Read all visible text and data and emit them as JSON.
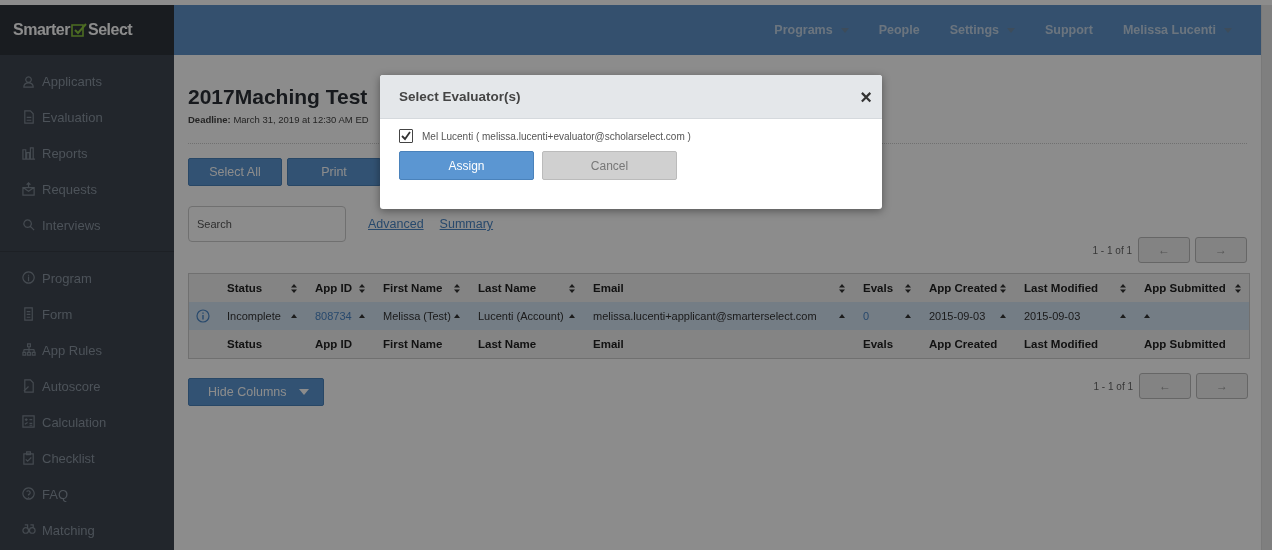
{
  "logo": {
    "before": "Smarter",
    "after": "Select"
  },
  "nav": [
    {
      "label": "Programs",
      "dropdown": true
    },
    {
      "label": "People",
      "dropdown": false
    },
    {
      "label": "Settings",
      "dropdown": true
    },
    {
      "label": "Support",
      "dropdown": false
    },
    {
      "label": "Melissa Lucenti",
      "dropdown": true
    }
  ],
  "sidebar": {
    "groups": [
      [
        {
          "label": "Applicants"
        },
        {
          "label": "Evaluation"
        },
        {
          "label": "Reports"
        },
        {
          "label": "Requests"
        },
        {
          "label": "Interviews"
        }
      ],
      [
        {
          "label": "Program"
        },
        {
          "label": "Form"
        },
        {
          "label": "App Rules"
        },
        {
          "label": "Autoscore"
        },
        {
          "label": "Calculation"
        },
        {
          "label": "Checklist"
        },
        {
          "label": "FAQ"
        },
        {
          "label": "Matching"
        }
      ]
    ]
  },
  "page": {
    "title": "2017Maching Test",
    "deadline_label": "Deadline:",
    "deadline": "March 31, 2019 at 12:30 AM ED"
  },
  "actions": [
    "Select All",
    "Print"
  ],
  "search": {
    "placeholder": "Search"
  },
  "links": [
    "Advanced",
    "Summary"
  ],
  "pagination": {
    "range": "1 - 1 of 1",
    "prev": "←",
    "next": "→"
  },
  "table": {
    "columns": [
      "Status",
      "App ID",
      "First Name",
      "Last Name",
      "Email",
      "Evals",
      "App Created",
      "Last Modified",
      "App Submitted"
    ],
    "rows": [
      {
        "selected": true,
        "cells": [
          {
            "text": "Incomplete",
            "link": false
          },
          {
            "text": "808734",
            "link": true
          },
          {
            "text": "Melissa (Test)",
            "link": false
          },
          {
            "text": "Lucenti (Account)",
            "link": false
          },
          {
            "text": "melissa.lucenti+applicant@smarterselect.com",
            "link": false
          },
          {
            "text": "0",
            "link": true
          },
          {
            "text": "2015-09-03",
            "link": false
          },
          {
            "text": "2015-09-03",
            "link": false
          },
          {}
        ]
      }
    ],
    "footer": [
      "Status",
      "App ID",
      "First Name",
      "Last Name",
      "Email",
      "Evals",
      "App Created",
      "Last Modified",
      "App Submitted"
    ]
  },
  "pagination_bottom": {
    "range": "1 - 1 of 1",
    "prev": "←",
    "next": "→"
  },
  "hide_columns": "Hide Columns",
  "modal": {
    "title": "Select Evaluator(s)",
    "close": "×",
    "options": [
      {
        "label": "Mel Lucenti ( melissa.lucenti+evaluator@scholarselect.com )",
        "checked": true
      }
    ],
    "buttons": [
      {
        "label": "Assign",
        "kind": "primary"
      },
      {
        "label": "Cancel",
        "kind": "secondary"
      }
    ]
  }
}
